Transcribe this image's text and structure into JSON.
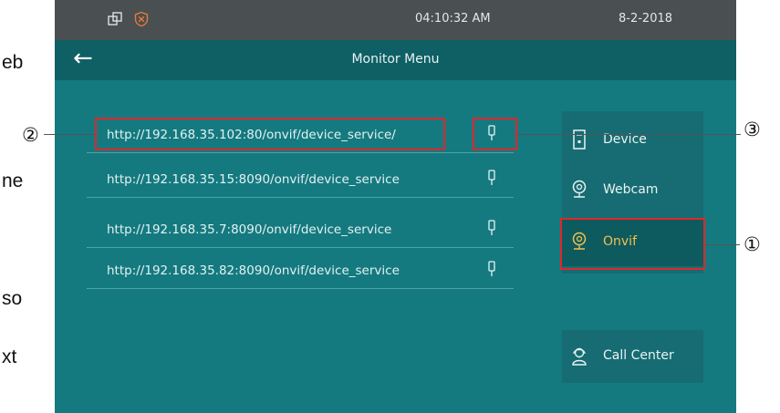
{
  "doc_fragments": [
    "eb",
    "ne",
    "so",
    "xt"
  ],
  "status_bar": {
    "time": "04:10:32   AM",
    "date": "8-2-2018",
    "icons": [
      "window-icon",
      "shield-x-icon"
    ]
  },
  "header": {
    "back_icon": "back-arrow-icon",
    "title": "Monitor Menu"
  },
  "urls": [
    {
      "url": "http://192.168.35.102:80/onvif/device_service/",
      "icon": "pin-icon"
    },
    {
      "url": "http://192.168.35.15:8090/onvif/device_service",
      "icon": "pin-icon"
    },
    {
      "url": "http://192.168.35.7:8090/onvif/device_service",
      "icon": "pin-icon"
    },
    {
      "url": "http://192.168.35.82:8090/onvif/device_service",
      "icon": "pin-icon"
    }
  ],
  "sidebar": {
    "items": [
      {
        "label": "Device",
        "icon": "intercom-device-icon",
        "active": false
      },
      {
        "label": "Webcam",
        "icon": "webcam-icon",
        "active": false
      },
      {
        "label": "Onvif",
        "icon": "onvif-camera-icon",
        "active": true
      }
    ],
    "call_center": {
      "label": "Call Center",
      "icon": "call-center-icon"
    }
  },
  "callouts": [
    "①",
    "②",
    "③"
  ],
  "colors": {
    "screen_bg": "#147a80",
    "status_bar": "#4a4f52",
    "title_bar": "#0e6065",
    "active_label": "#f5c04a",
    "callout_red": "#e0262b"
  }
}
